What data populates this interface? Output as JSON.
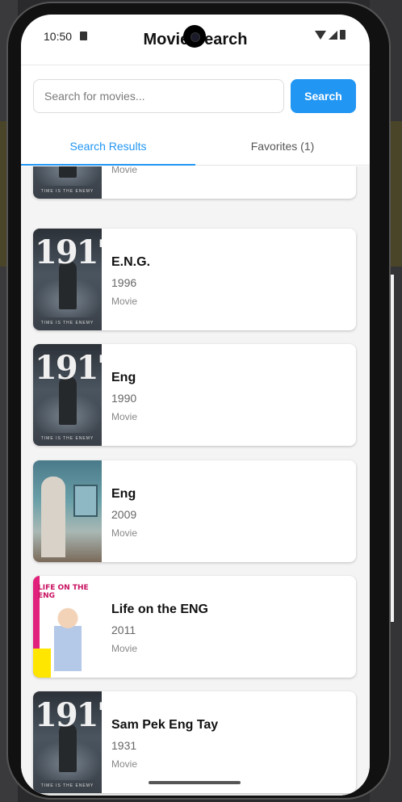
{
  "status": {
    "time": "10:50"
  },
  "app": {
    "title": "Movie Search"
  },
  "search": {
    "placeholder": "Search for movies...",
    "value": "",
    "button_label": "Search"
  },
  "tabs": [
    {
      "label": "Search Results",
      "active": true
    },
    {
      "label": "Favorites (1)",
      "active": false
    }
  ],
  "colors": {
    "accent": "#2196f3"
  },
  "results": [
    {
      "title": "",
      "year": "",
      "type": "Movie",
      "poster": "1917"
    },
    {
      "title": "E.N.G.",
      "year": "1996",
      "type": "Movie",
      "poster": "1917"
    },
    {
      "title": "Eng",
      "year": "1990",
      "type": "Movie",
      "poster": "1917"
    },
    {
      "title": "Eng",
      "year": "2009",
      "type": "Movie",
      "poster": "eng-2009"
    },
    {
      "title": "Life on the ENG",
      "year": "2011",
      "type": "Movie",
      "poster": "life-on-the-eng"
    },
    {
      "title": "Sam Pek Eng Tay",
      "year": "1931",
      "type": "Movie",
      "poster": "1917"
    }
  ],
  "poster_text": {
    "p1917_title": "1917",
    "p1917_tagline": "TIME IS THE ENEMY",
    "life_title": "LIFE ON THE ENG"
  }
}
